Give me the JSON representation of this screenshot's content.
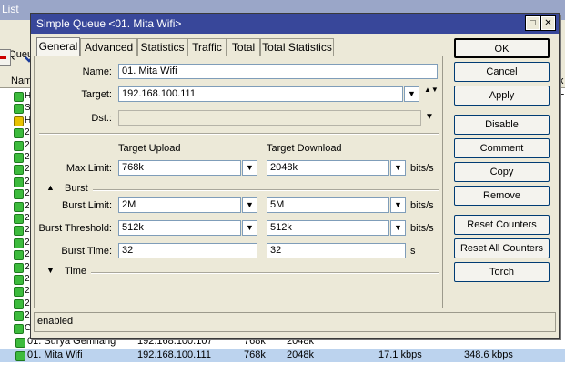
{
  "background": {
    "title": "List",
    "toolbar_label": "e Queue",
    "header_label": "Nam",
    "header_right": "x L",
    "rows": [
      {
        "name": "01. Surya Gemilang",
        "target": "192.168.100.107",
        "upload": "768k",
        "download": "2048k",
        "rate_up": "",
        "rate_down": ""
      },
      {
        "name": "01. Mita Wifi",
        "target": "192.168.100.111",
        "upload": "768k",
        "download": "2048k",
        "rate_up": "17.1 kbps",
        "rate_down": "348.6 kbps"
      }
    ],
    "side_chars": [
      "H",
      "S",
      "H",
      "2",
      "2",
      "2",
      "2",
      "2",
      "2",
      "2",
      "2",
      "2",
      "2",
      "2",
      "2",
      "2",
      "2",
      "2",
      "2",
      "C"
    ]
  },
  "dialog": {
    "title": "Simple Queue <01. Mita Wifi>",
    "controls": {
      "restore": "□",
      "close": "✕"
    },
    "tabs": [
      "General",
      "Advanced",
      "Statistics",
      "Traffic",
      "Total",
      "Total Statistics"
    ],
    "active_tab": "General",
    "form": {
      "name_label": "Name:",
      "name_value": "01. Mita Wifi",
      "target_label": "Target:",
      "target_value": "192.168.100.111",
      "dst_label": "Dst.:",
      "dst_value": "",
      "target_upload_head": "Target Upload",
      "target_download_head": "Target Download",
      "max_limit_label": "Max Limit:",
      "max_limit_up": "768k",
      "max_limit_down": "2048k",
      "unit_bits": "bits/s",
      "burst_section": "Burst",
      "burst_limit_label": "Burst Limit:",
      "burst_limit_up": "2M",
      "burst_limit_down": "5M",
      "burst_threshold_label": "Burst Threshold:",
      "burst_threshold_up": "512k",
      "burst_threshold_down": "512k",
      "burst_time_label": "Burst Time:",
      "burst_time_up": "32",
      "burst_time_down": "32",
      "unit_s": "s",
      "time_section": "Time"
    },
    "buttons": {
      "ok": "OK",
      "cancel": "Cancel",
      "apply": "Apply",
      "disable": "Disable",
      "comment": "Comment",
      "copy": "Copy",
      "remove": "Remove",
      "reset_counters": "Reset Counters",
      "reset_all_counters": "Reset All Counters",
      "torch": "Torch"
    },
    "status": "enabled"
  },
  "icons": {
    "dropdown": "▼",
    "updown": "▲▼",
    "collapse": "▲",
    "expand": "▼"
  },
  "colors": {
    "titlebar_active": "#38479a",
    "titlebar_inactive": "#9aa6c8",
    "selected_row": "#bcd3ee",
    "queue_icon": "#3dbb3d"
  }
}
